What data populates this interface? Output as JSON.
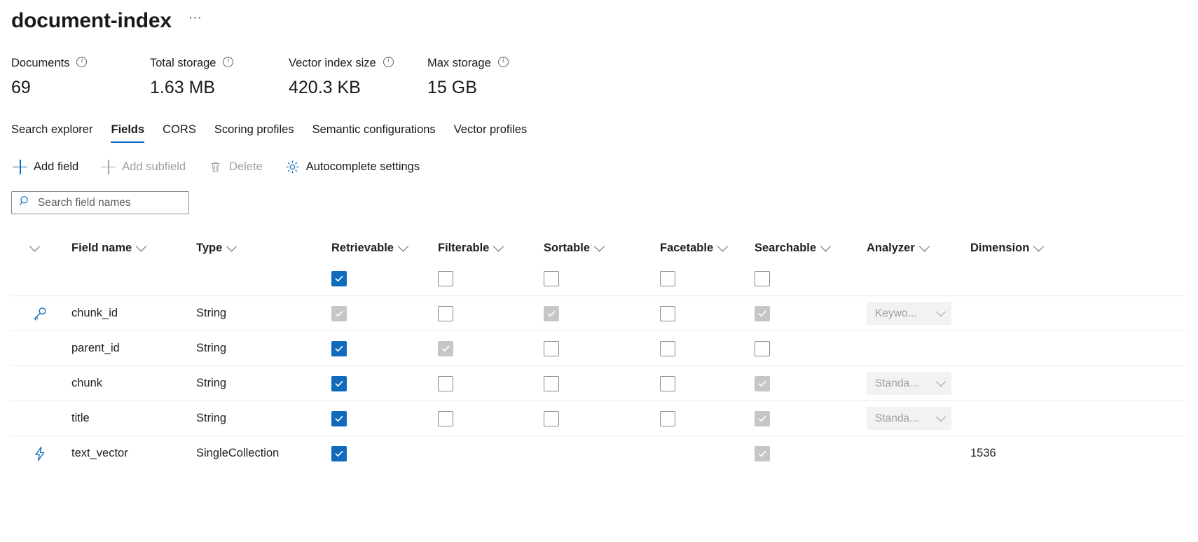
{
  "header": {
    "title": "document-index",
    "more_label": "···",
    "more_name": "more-options-icon"
  },
  "stats": [
    {
      "label": "Documents",
      "value": "69",
      "info_icon": "info-icon"
    },
    {
      "label": "Total storage",
      "value": "1.63 MB",
      "info_icon": "info-icon"
    },
    {
      "label": "Vector index size",
      "value": "420.3 KB",
      "info_icon": "info-icon"
    },
    {
      "label": "Max storage",
      "value": "15 GB",
      "info_icon": "info-icon"
    }
  ],
  "tabs": [
    {
      "label": "Search explorer",
      "active": false
    },
    {
      "label": "Fields",
      "active": true
    },
    {
      "label": "CORS",
      "active": false
    },
    {
      "label": "Scoring profiles",
      "active": false
    },
    {
      "label": "Semantic configurations",
      "active": false
    },
    {
      "label": "Vector profiles",
      "active": false
    }
  ],
  "commands": [
    {
      "label": "Add field",
      "icon": "plus-icon",
      "disabled": false
    },
    {
      "label": "Add subfield",
      "icon": "plus-icon",
      "disabled": true
    },
    {
      "label": "Delete",
      "icon": "trash-icon",
      "disabled": true
    },
    {
      "label": "Autocomplete settings",
      "icon": "gear-icon",
      "disabled": false
    }
  ],
  "search": {
    "placeholder": "Search field names",
    "value": "",
    "icon": "search-icon"
  },
  "table": {
    "columns": [
      {
        "key": "expand",
        "label": ""
      },
      {
        "key": "name",
        "label": "Field name"
      },
      {
        "key": "type",
        "label": "Type"
      },
      {
        "key": "retrievable",
        "label": "Retrievable"
      },
      {
        "key": "filterable",
        "label": "Filterable"
      },
      {
        "key": "sortable",
        "label": "Sortable"
      },
      {
        "key": "facetable",
        "label": "Facetable"
      },
      {
        "key": "searchable",
        "label": "Searchable"
      },
      {
        "key": "analyzer",
        "label": "Analyzer"
      },
      {
        "key": "dimension",
        "label": "Dimension"
      }
    ],
    "select_all": {
      "retrievable": "on",
      "filterable": "off",
      "sortable": "off",
      "facetable": "off",
      "searchable": "off"
    },
    "rows": [
      {
        "icon": "key-icon",
        "name": "chunk_id",
        "type": "String",
        "retrievable": "on-disabled",
        "filterable": "off",
        "sortable": "on-disabled",
        "facetable": "off",
        "searchable": "on-disabled",
        "analyzer": "Keywo...",
        "dimension": ""
      },
      {
        "icon": "",
        "name": "parent_id",
        "type": "String",
        "retrievable": "on",
        "filterable": "on-disabled",
        "sortable": "off",
        "facetable": "off",
        "searchable": "off",
        "analyzer": "",
        "dimension": ""
      },
      {
        "icon": "",
        "name": "chunk",
        "type": "String",
        "retrievable": "on",
        "filterable": "off",
        "sortable": "off",
        "facetable": "off",
        "searchable": "on-disabled",
        "analyzer": "Standa...",
        "dimension": ""
      },
      {
        "icon": "",
        "name": "title",
        "type": "String",
        "retrievable": "on",
        "filterable": "off",
        "sortable": "off",
        "facetable": "off",
        "searchable": "on-disabled",
        "analyzer": "Standa...",
        "dimension": ""
      },
      {
        "icon": "vector-icon",
        "name": "text_vector",
        "type": "SingleCollection",
        "retrievable": "on",
        "filterable": "blank",
        "sortable": "blank",
        "facetable": "blank",
        "searchable": "on-disabled",
        "analyzer": "",
        "dimension": "1536"
      }
    ]
  },
  "colors": {
    "accent": "#0f6cbd",
    "disabled_check": "#c8c6c4",
    "text": "#201f1e",
    "muted": "#605e5c",
    "border": "#8a8886",
    "divider": "#edebe9"
  }
}
